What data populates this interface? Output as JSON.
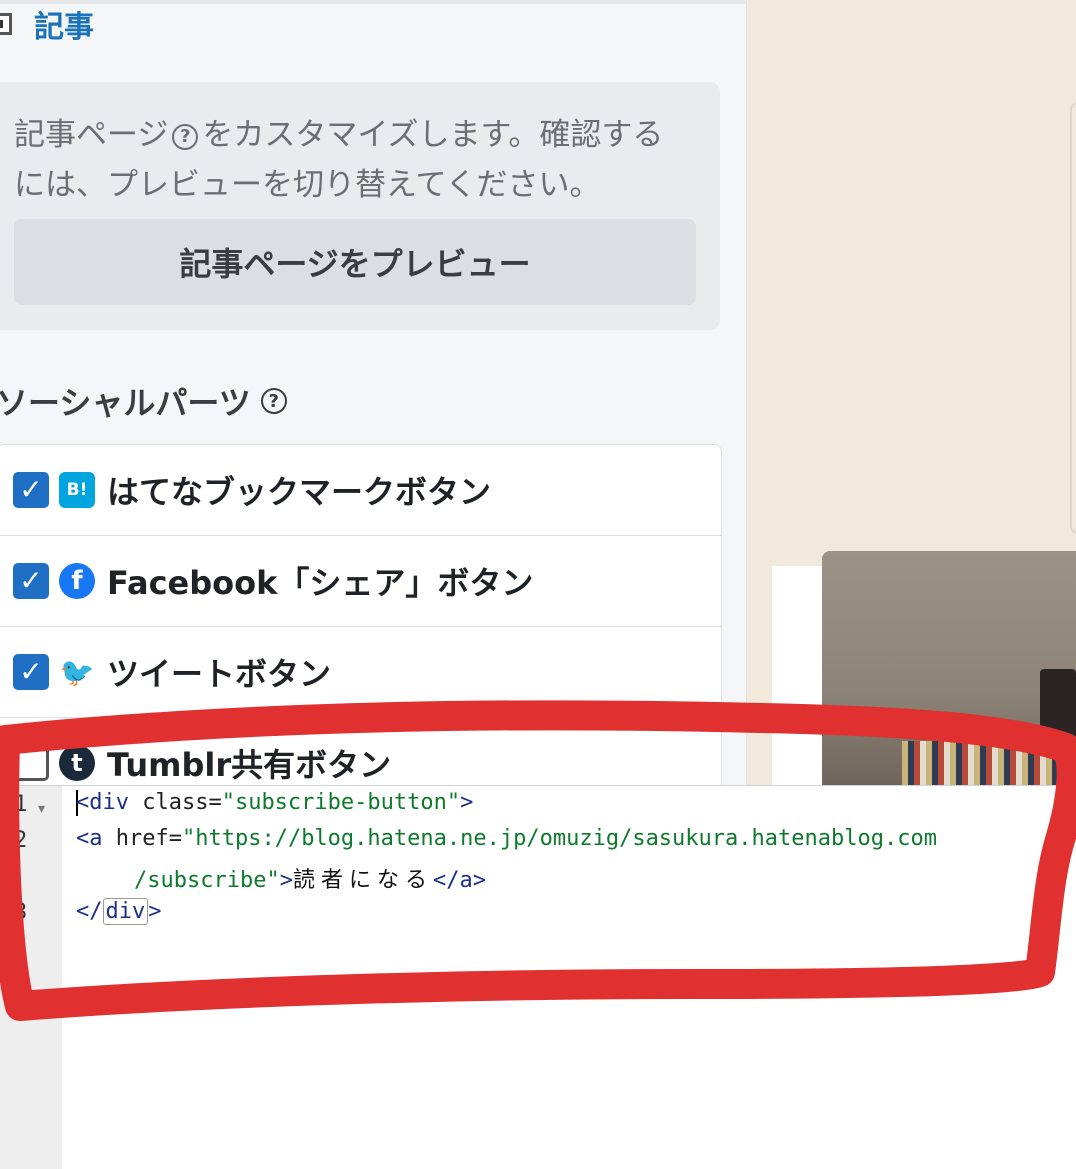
{
  "section": {
    "title": "記事"
  },
  "info": {
    "text_before": "記事ページ",
    "help": "?",
    "text_after": "をカスタマイズします。確認するには、プレビューを切り替えてください。",
    "preview_button": "記事ページをプレビュー"
  },
  "social": {
    "title": "ソーシャルパーツ",
    "help": "?",
    "items": [
      {
        "label": "はてなブックマークボタン",
        "icon": "hatena-bookmark-icon",
        "icon_text": "B!",
        "checked": true
      },
      {
        "label": "Facebook「シェア」ボタン",
        "icon": "facebook-icon",
        "icon_text": "f",
        "checked": true
      },
      {
        "label": "ツイートボタン",
        "icon": "twitter-icon",
        "icon_text": "🐦",
        "checked": true
      },
      {
        "label": "Tumblr共有ボタン",
        "icon": "tumblr-icon",
        "icon_text": "t",
        "checked": false
      }
    ]
  },
  "editor": {
    "line_numbers": [
      "1",
      "2",
      "3"
    ],
    "line1": {
      "open": "<div",
      "attr": " class=",
      "value": "\"subscribe-button\"",
      "close": ">"
    },
    "line2": {
      "open": "<a",
      "attr": " href=",
      "value_a": "\"https://blog.hatena.ne.jp/omuzig/sasukura.hatenablog.com",
      "value_b": "/subscribe\"",
      "gt": ">",
      "text": "読者になる",
      "end": "</a>"
    },
    "line3": {
      "open": "</",
      "name": "div",
      "close": ">"
    }
  },
  "colors": {
    "accent": "#1f6fc5",
    "section_title": "#1a73b8",
    "annotation": "#e03030",
    "preview_bg": "#f1e9dc"
  }
}
